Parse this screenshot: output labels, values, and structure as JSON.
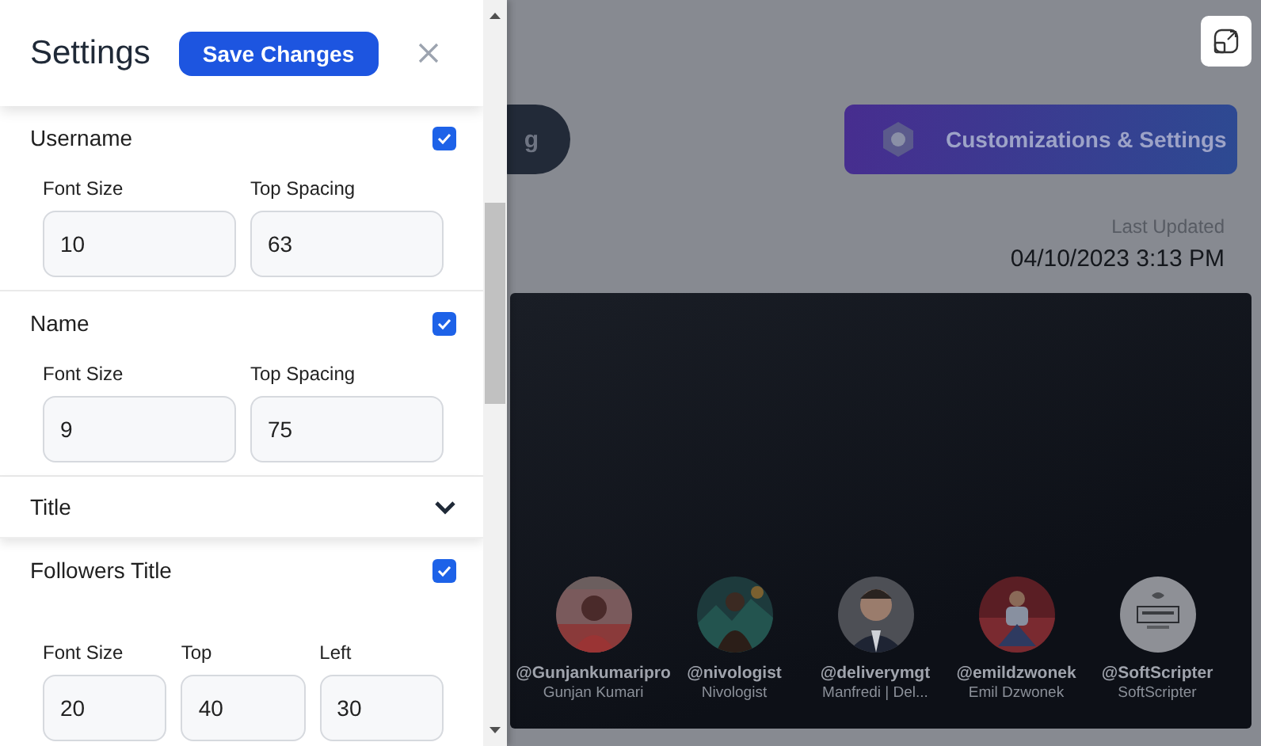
{
  "settings": {
    "title": "Settings",
    "save_button": "Save Changes",
    "sections": [
      {
        "kind": "toggle",
        "label": "Username",
        "checked": true,
        "fields": [
          {
            "label": "Font Size",
            "value": "10"
          },
          {
            "label": "Top Spacing",
            "value": "63"
          }
        ]
      },
      {
        "kind": "toggle",
        "label": "Name",
        "checked": true,
        "fields": [
          {
            "label": "Font Size",
            "value": "9"
          },
          {
            "label": "Top Spacing",
            "value": "75"
          }
        ]
      },
      {
        "kind": "collapsible",
        "label": "Title",
        "expanded": false
      },
      {
        "kind": "toggle",
        "label": "Followers Title",
        "checked": true,
        "fields": [
          {
            "label": "Font Size",
            "value": "20"
          },
          {
            "label": "Top",
            "value": "40"
          },
          {
            "label": "Left",
            "value": "30"
          }
        ]
      }
    ]
  },
  "backdrop": {
    "partial_button": "g",
    "customize_button": "Customizations & Settings",
    "last_updated_label": "Last Updated",
    "last_updated": "04/10/2023 3:13 PM",
    "profiles": [
      {
        "handle": "@Gunjankumaripro",
        "name": "Gunjan Kumari"
      },
      {
        "handle": "@nivologist",
        "name": "Nivologist"
      },
      {
        "handle": "@deliverymgt",
        "name": "Manfredi | Del..."
      },
      {
        "handle": "@emildzwonek",
        "name": "Emil Dzwonek"
      },
      {
        "handle": "@SoftScripter",
        "name": "SoftScripter"
      }
    ]
  }
}
